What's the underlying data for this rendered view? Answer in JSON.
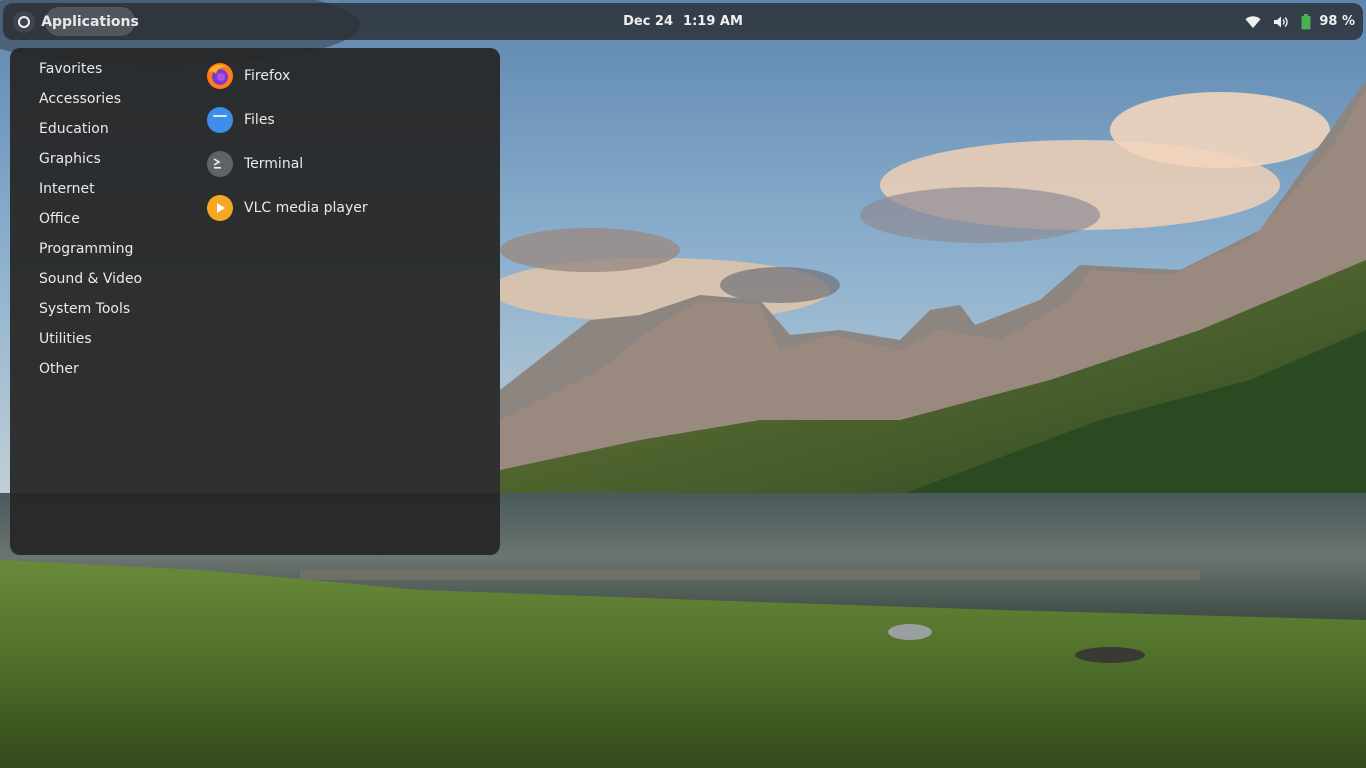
{
  "topbar": {
    "applications_label": "Applications",
    "date": "Dec 24",
    "time": "1:19 AM",
    "battery_percent": "98 %",
    "icons": [
      "activities-icon",
      "wifi-icon",
      "volume-icon",
      "battery-icon"
    ]
  },
  "menu": {
    "categories": [
      {
        "label": "Favorites"
      },
      {
        "label": "Accessories"
      },
      {
        "label": "Education"
      },
      {
        "label": "Graphics"
      },
      {
        "label": "Internet"
      },
      {
        "label": "Office"
      },
      {
        "label": "Programming"
      },
      {
        "label": "Sound & Video"
      },
      {
        "label": "System Tools"
      },
      {
        "label": "Utilities"
      },
      {
        "label": "Other"
      }
    ],
    "apps": [
      {
        "label": "Firefox",
        "icon": "firefox-icon"
      },
      {
        "label": "Files",
        "icon": "files-icon"
      },
      {
        "label": "Terminal",
        "icon": "terminal-icon"
      },
      {
        "label": "VLC media player",
        "icon": "vlc-icon"
      }
    ]
  },
  "colors": {
    "topbar_bg": "#2a2c2e",
    "menu_bg": "#262626",
    "battery_green": "#4caf50",
    "vlc_orange": "#f5a623",
    "files_blue": "#3d8ee8"
  }
}
